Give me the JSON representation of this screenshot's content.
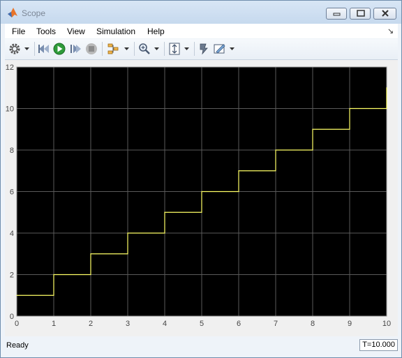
{
  "window": {
    "title": "Scope"
  },
  "menu": {
    "items": [
      "File",
      "Tools",
      "View",
      "Simulation",
      "Help"
    ]
  },
  "toolbar": {
    "icons": [
      "gear-icon",
      "step-back-icon",
      "run-icon",
      "step-forward-icon",
      "stop-icon",
      "signal-selector-icon",
      "zoom-icon",
      "scale-axes-icon",
      "highlight-icon",
      "style-icon"
    ]
  },
  "chart_data": {
    "type": "line",
    "style": "stairs",
    "background": "#000000",
    "line_color": "#ffff66",
    "grid": true,
    "xlim": [
      0,
      10
    ],
    "ylim": [
      0,
      12
    ],
    "xticks": [
      "0",
      "1",
      "2",
      "3",
      "4",
      "5",
      "6",
      "7",
      "8",
      "9",
      "10"
    ],
    "yticks": [
      "0",
      "2",
      "4",
      "6",
      "8",
      "10",
      "12"
    ],
    "series": [
      {
        "x": [
          0,
          1,
          2,
          3,
          4,
          5,
          6,
          7,
          8,
          9,
          10
        ],
        "values": [
          1,
          2,
          3,
          4,
          5,
          6,
          7,
          8,
          9,
          10,
          11
        ]
      }
    ]
  },
  "status": {
    "text": "Ready",
    "time": "T=10.000"
  }
}
